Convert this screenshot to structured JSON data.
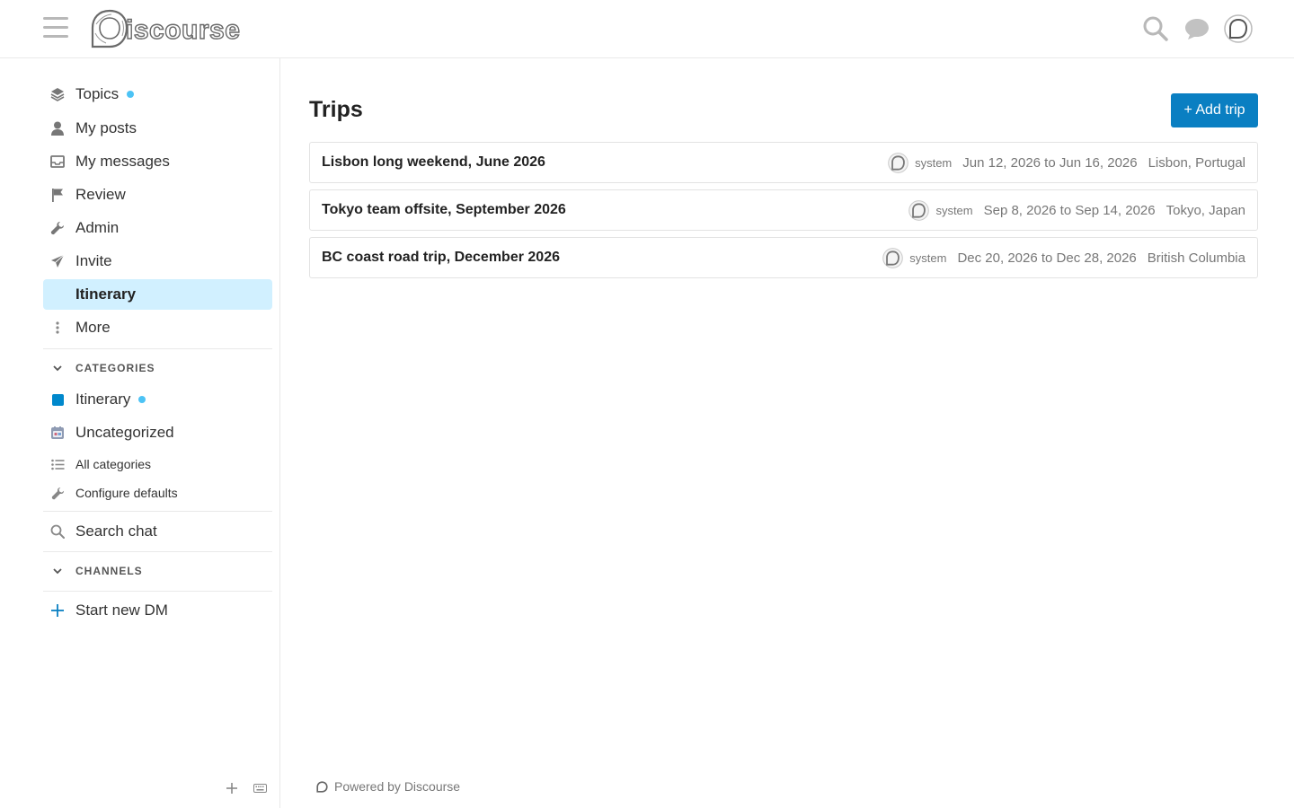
{
  "header": {
    "logo_text": "iscourse",
    "icons": [
      "hamburger-icon",
      "search-icon",
      "chat-icon",
      "avatar"
    ]
  },
  "sidebar": {
    "items": [
      {
        "label": "Topics",
        "icon": "layers-icon",
        "dot": true
      },
      {
        "label": "My posts",
        "icon": "user-icon"
      },
      {
        "label": "My messages",
        "icon": "inbox-icon"
      },
      {
        "label": "Review",
        "icon": "flag-icon"
      },
      {
        "label": "Admin",
        "icon": "wrench-icon"
      },
      {
        "label": "Invite",
        "icon": "paper-plane-icon"
      },
      {
        "label": "Itinerary",
        "active": true
      },
      {
        "label": "More",
        "icon": "vertical-ellipsis-icon"
      }
    ],
    "categories": {
      "heading": "CATEGORIES",
      "items": [
        {
          "label": "Itinerary",
          "color": "#0088cc",
          "dot": true
        },
        {
          "label": "Uncategorized",
          "icon": "category-logo-icon"
        },
        {
          "label": "All categories",
          "icon": "list-icon"
        },
        {
          "label": "Configure defaults",
          "icon": "wrench-icon"
        }
      ]
    },
    "search_chat": "Search chat",
    "channels": {
      "heading": "CHANNELS"
    },
    "start_dm": "Start new DM"
  },
  "main": {
    "title": "Trips",
    "add_button": "+ Add trip",
    "trips": [
      {
        "title": "Lisbon long weekend, June 2026",
        "user": "system",
        "dates": "Jun 12, 2026 to Jun 16, 2026",
        "location": "Lisbon, Portugal"
      },
      {
        "title": "Tokyo team offsite, September 2026",
        "user": "system",
        "dates": "Sep 8, 2026 to Sep 14, 2026",
        "location": "Tokyo, Japan"
      },
      {
        "title": "BC coast road trip, December 2026",
        "user": "system",
        "dates": "Dec 20, 2026 to Dec 28, 2026",
        "location": "British Columbia"
      }
    ],
    "powered_by": "Powered by Discourse"
  },
  "colors": {
    "accent": "#0a7fc2",
    "active_bg": "#d1f0ff",
    "dot": "#4dc3f5",
    "category_itinerary": "#0088cc"
  }
}
